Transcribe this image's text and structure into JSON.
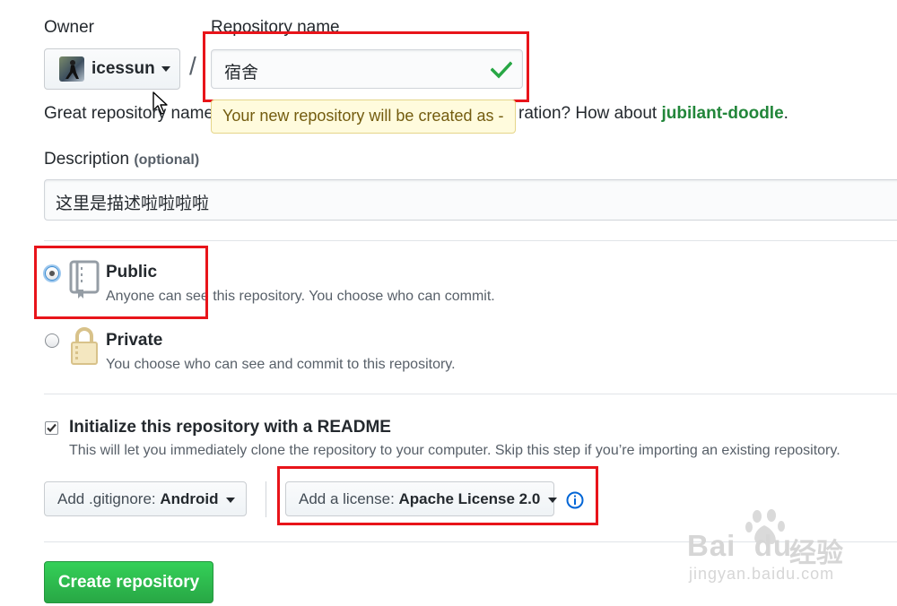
{
  "owner": {
    "label": "Owner",
    "username": "icessun"
  },
  "slash": "/",
  "repo_name": {
    "label": "Repository name",
    "value": "宿舍",
    "status_icon": "check-icon"
  },
  "suggestion": {
    "prefix": "Great repository name",
    "middle": "ration? How about ",
    "name": "jubilant-doodle",
    "suffix": "."
  },
  "tooltip": {
    "text": "Your new repository will be created as -"
  },
  "description": {
    "label": "Description",
    "optional": "(optional)",
    "value": "这里是描述啦啦啦啦"
  },
  "visibility": {
    "public": {
      "label": "Public",
      "desc": "Anyone can see this repository. You choose who can commit.",
      "selected": true,
      "icon": "repo-book-icon"
    },
    "private": {
      "label": "Private",
      "desc": "You choose who can see and commit to this repository.",
      "selected": false,
      "icon": "lock-icon"
    }
  },
  "readme": {
    "label": "Initialize this repository with a README",
    "desc": "This will let you immediately clone the repository to your computer. Skip this step if you’re importing an existing repository.",
    "checked": true
  },
  "gitignore": {
    "prefix": "Add .gitignore: ",
    "value": "Android"
  },
  "license": {
    "prefix": "Add a license: ",
    "value": "Apache License 2.0",
    "info_icon": "info-icon"
  },
  "submit": {
    "label": "Create repository"
  },
  "watermark": {
    "brand": "Bai  du",
    "brand_cn": "经验",
    "url": "jingyan.baidu.com"
  },
  "colors": {
    "accent_green": "#2cbe4e",
    "check_green": "#28a745",
    "link_green": "#22863a",
    "highlight_red": "#e8141a",
    "info_blue": "#0366d6",
    "tooltip_bg": "#fffbdd"
  }
}
